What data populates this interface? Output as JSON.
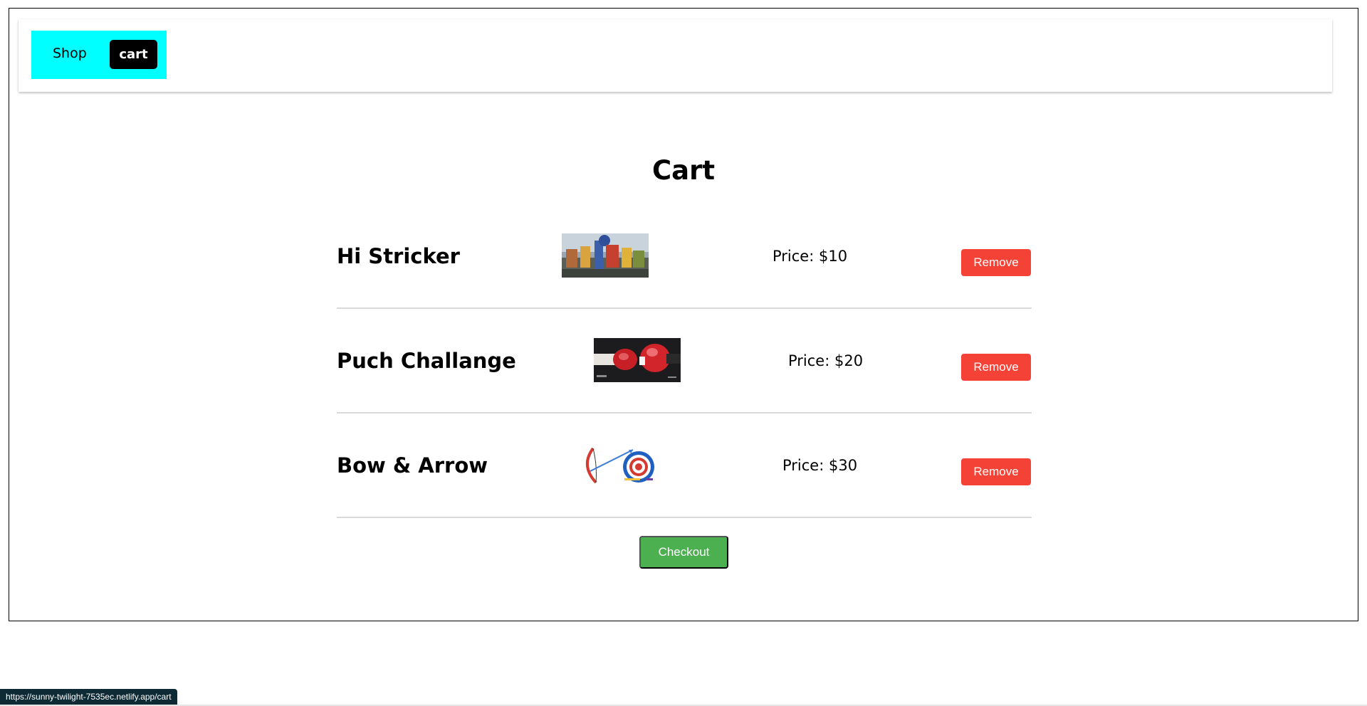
{
  "navbar": {
    "shop_label": "Shop",
    "cart_label": "cart"
  },
  "page": {
    "title": "Cart"
  },
  "cart": {
    "items": [
      {
        "name": "Hi Stricker",
        "price": "Price: $10",
        "remove_label": "Remove",
        "image_icon": "high-striker-game-image"
      },
      {
        "name": "Puch Challange",
        "price": "Price: $20",
        "remove_label": "Remove",
        "image_icon": "boxing-gloves-image"
      },
      {
        "name": "Bow & Arrow",
        "price": "Price: $30",
        "remove_label": "Remove",
        "image_icon": "bow-and-arrow-target-image"
      }
    ],
    "checkout_label": "Checkout"
  },
  "status_bar": {
    "url": "https://sunny-twilight-7535ec.netlify.app/cart"
  },
  "colors": {
    "nav_highlight": "#00ffff",
    "remove_button": "#f44336",
    "checkout_button": "#4caf50"
  }
}
